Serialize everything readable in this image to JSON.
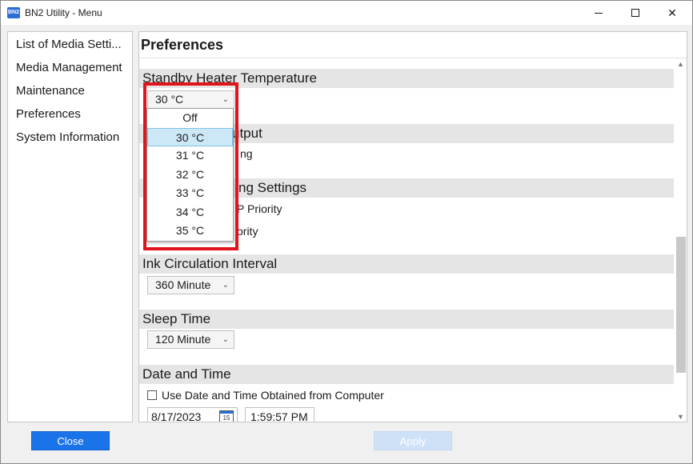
{
  "window": {
    "title": "BN2 Utility - Menu",
    "app_icon_text": "BN2",
    "controls": [
      "minimize",
      "maximize",
      "close"
    ]
  },
  "sidebar": {
    "items": [
      {
        "label": "List of Media Setti..."
      },
      {
        "label": "Media Management"
      },
      {
        "label": "Maintenance"
      },
      {
        "label": "Preferences"
      },
      {
        "label": "System Information"
      }
    ]
  },
  "footer": {
    "close_label": "Close",
    "apply_label": "Apply"
  },
  "main": {
    "title": "Preferences",
    "sections": {
      "standby_heater": {
        "header": "Standby Heater Temperature",
        "value": "30 °C",
        "options": [
          "Off",
          "30 °C",
          "31 °C",
          "32 °C",
          "33 °C",
          "34 °C",
          "35 °C"
        ],
        "selected_option": "30 °C"
      },
      "output": {
        "header_fragment": "utput",
        "row_fragment": "ng"
      },
      "settings": {
        "header_fragment": "ng Settings",
        "row1_fragment": "P Priority",
        "row2_fragment": "ority"
      },
      "ink_circulation": {
        "header": "Ink Circulation Interval",
        "value": "360 Minute"
      },
      "sleep_time": {
        "header": "Sleep Time",
        "value": "120 Minute"
      },
      "date_time": {
        "header": "Date and Time",
        "checkbox_label": "Use Date and Time Obtained from Computer",
        "checkbox_checked": false,
        "date_value": "8/17/2023",
        "calendar_day": "15",
        "time_value": "1:59:57 PM"
      }
    }
  },
  "colors": {
    "accent": "#1a73e8",
    "highlight": "#e0141b",
    "section_bg": "#e5e5e5",
    "selected_option_bg": "#cce8f6"
  }
}
